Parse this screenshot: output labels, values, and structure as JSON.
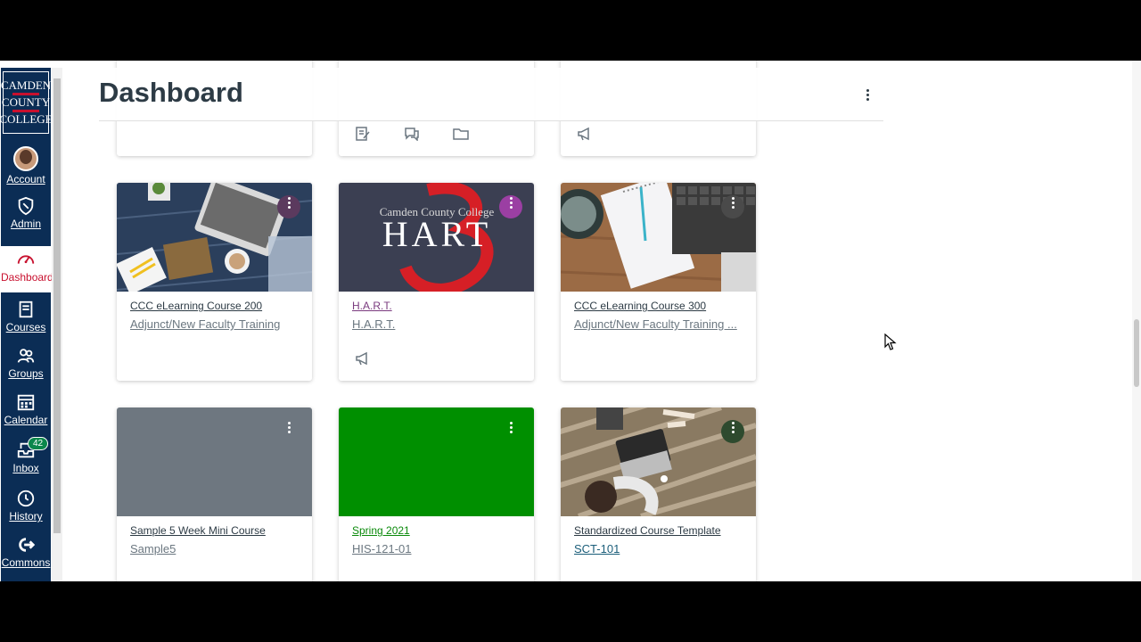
{
  "window": {
    "title": "Dashboard"
  },
  "nav": {
    "logo_lines": [
      "CAMDEN",
      "COUNTY",
      "COLLEGE"
    ],
    "items": [
      {
        "label": "Account",
        "icon": "avatar"
      },
      {
        "label": "Admin",
        "icon": "shield-icon"
      },
      {
        "label": "Dashboard",
        "icon": "gauge-icon",
        "active": true
      },
      {
        "label": "Courses",
        "icon": "book-icon"
      },
      {
        "label": "Groups",
        "icon": "people-icon"
      },
      {
        "label": "Calendar",
        "icon": "calendar-icon"
      },
      {
        "label": "Inbox",
        "icon": "inbox-icon",
        "badge": "42"
      },
      {
        "label": "History",
        "icon": "clock-icon"
      },
      {
        "label": "Commons",
        "icon": "commons-icon"
      }
    ]
  },
  "header": {
    "title": "Dashboard"
  },
  "cards": [
    {
      "title": "CCC eLearning Course 200",
      "subtitle": "Adjunct/New Faculty Training",
      "hero": "photo-laptop-desk",
      "title_color": "#2d3b45",
      "kebab_bg": "#5b3a5e"
    },
    {
      "title": "H.A.R.T.",
      "subtitle": "H.A.R.T.",
      "hero": "hart-logo",
      "hero_text_top": "Camden County College",
      "hero_text_big": "HART",
      "title_color": "#7a3a7e",
      "kebab_bg": "#9b3fa3"
    },
    {
      "title": "CCC eLearning Course 300",
      "subtitle": "Adjunct/New Faculty Training ...",
      "hero": "photo-notepad-keyboard",
      "title_color": "#2d3b45",
      "kebab_bg": "#4a4a4a"
    },
    {
      "title": "Sample 5 Week Mini Course",
      "subtitle": "Sample5",
      "hero": "gray",
      "title_color": "#2d3b45",
      "kebab_bg": "transparent"
    },
    {
      "title": "Spring 2021",
      "subtitle": "HIS-121-01",
      "hero": "green",
      "title_color": "#0b8a0b",
      "kebab_bg": "transparent"
    },
    {
      "title": "Standardized Course Template",
      "subtitle": "SCT-101",
      "hero": "photo-laptop-deck",
      "title_color": "#2d3b45",
      "subtitle_color": "#1b5e7a",
      "kebab_bg": "#2e4a2e"
    }
  ],
  "colors": {
    "nav_bg": "#0b2d55",
    "accent_red": "#c8102e",
    "badge_green": "#0b874b",
    "green_hero": "#008f00",
    "gray_hero": "#6e7780"
  }
}
